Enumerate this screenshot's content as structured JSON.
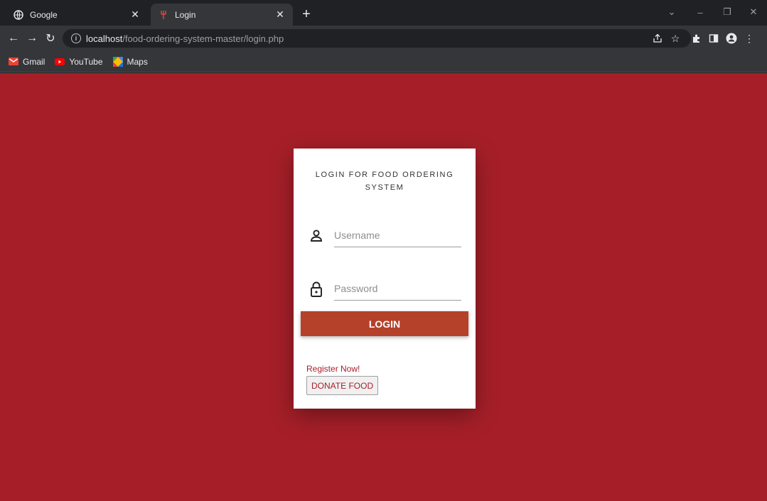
{
  "browser": {
    "tabs": [
      {
        "title": "Google",
        "icon": "globe-icon",
        "active": false
      },
      {
        "title": "Login",
        "icon": "fork-icon",
        "active": true
      }
    ],
    "new_tab_label": "+",
    "address": {
      "host": "localhost",
      "path": "/food-ordering-system-master/login.php"
    },
    "bookmarks": [
      {
        "label": "Gmail",
        "icon": "gmail-icon"
      },
      {
        "label": "YouTube",
        "icon": "youtube-icon"
      },
      {
        "label": "Maps",
        "icon": "maps-icon"
      }
    ]
  },
  "login": {
    "title": "LOGIN FOR FOOD ORDERING SYSTEM",
    "username_placeholder": "Username",
    "password_placeholder": "Password",
    "login_label": "LOGIN",
    "register_label": "Register Now!",
    "donate_label": "DONATE FOOD"
  },
  "colors": {
    "page_background": "#a61f28",
    "login_button": "#b5412a",
    "link": "#a61f28"
  }
}
